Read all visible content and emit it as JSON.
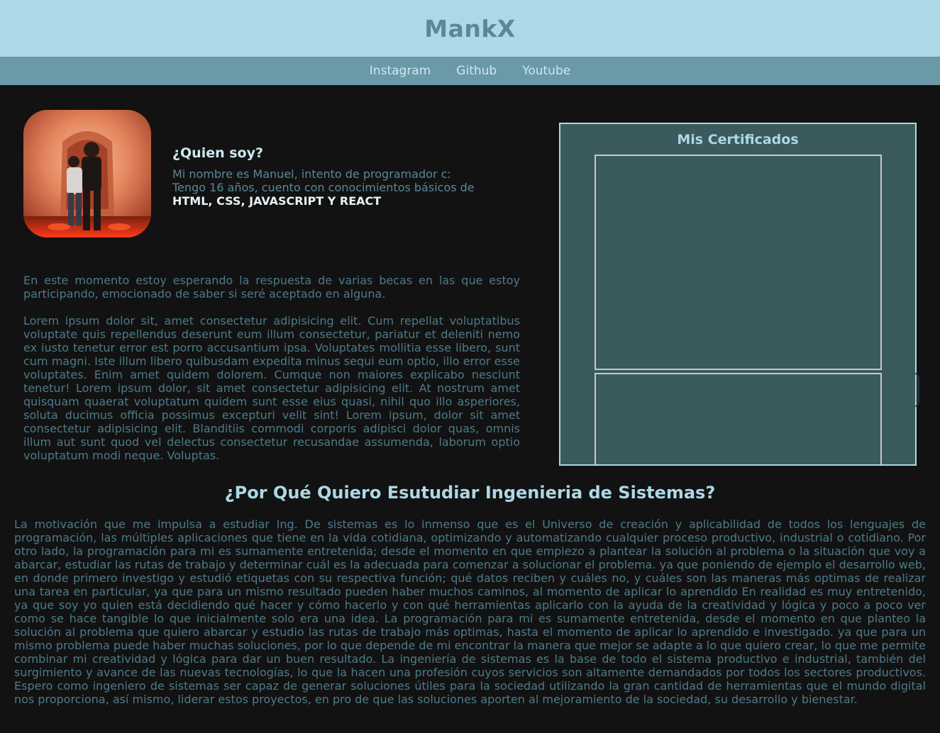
{
  "header": {
    "title": "MankX"
  },
  "nav": {
    "links": [
      {
        "label": "Instagram"
      },
      {
        "label": "Github"
      },
      {
        "label": "Youtube"
      }
    ]
  },
  "about": {
    "heading": "¿Quien soy?",
    "line1": "Mi nombre es Manuel, intento de programador c:",
    "line2": "Tengo 16 años, cuento con conocimientos básicos de",
    "skills": "HTML, CSS, JAVASCRIPT Y REACT"
  },
  "intro": {
    "paragraph1": "En este momento estoy esperando la respuesta de varias becas en las que estoy participando, emocionado de saber si seré aceptado en alguna.",
    "paragraph2": "Lorem ipsum dolor sit, amet consectetur adipisicing elit. Cum repellat voluptatibus voluptate quis repellendus deserunt eum illum consectetur, pariatur et deleniti nemo ex iusto tenetur error est porro accusantium ipsa. Voluptates mollitia esse libero, sunt cum magni. Iste illum libero quibusdam expedita minus sequi eum optio, illo error esse voluptates. Enim amet quidem dolorem. Cumque non maiores explicabo nesciunt tenetur! Lorem ipsum dolor, sit amet consectetur adipisicing elit. At nostrum amet quisquam quaerat voluptatum quidem sunt esse eius quasi, nihil quo illo asperiores, soluta ducimus officia possimus excepturi velit sint! Lorem ipsum, dolor sit amet consectetur adipisicing elit. Blanditiis commodi corporis adipisci dolor quas, omnis illum aut sunt quod vel delectus consectetur recusandae assumenda, laborum optio voluptatum modi neque. Voluptas."
  },
  "certificates": {
    "title": "Mis Certificados"
  },
  "why": {
    "heading": "¿Por Qué Quiero Esutudiar Ingenieria de Sistemas?",
    "text": "La motivación que me impulsa a estudiar Ing. De sistemas es lo inmenso que es el Universo de creación y aplicabilidad de todos los lenguajes de programación, las múltiples aplicaciones que tiene en la vida cotidiana, optimizando y automatizando cualquier proceso productivo, industrial o cotidiano. Por otro lado, la programación para mi es sumamente entretenida; desde el momento en que empiezo a plantear la solución al problema o la situación que voy a abarcar, estudiar las rutas de trabajo y determinar cuál es la adecuada para comenzar a solucionar el problema. ya que poniendo de ejemplo el desarrollo web, en donde primero investigo y estudió etiquetas con su respectiva función; qué datos reciben y cuáles no, y cuáles son las maneras más optimas de realizar una tarea en particular, ya que para un mismo resultado pueden haber muchos caminos, al momento de aplicar lo aprendido En realidad es muy entretenido, ya que soy yo quien está decidiendo qué hacer y cómo hacerlo y con qué herramientas aplicarlo con la ayuda de la creatividad y lógica y poco a poco ver como se hace tangible lo que inicialmente solo era una idea. La programación para mi es sumamente entretenida, desde el momento en que planteo la solución al problema que quiero abarcar y estudio las rutas de trabajo más optimas, hasta el momento de aplicar lo aprendido e investigado. ya que para un mismo problema puede haber muchas soluciones, por lo que depende de mi encontrar la manera que mejor se adapte a lo que quiero crear, lo que me permite combinar mi creatividad y lógica para dar un buen resultado. La ingeniería de sistemas es la base de todo el sistema productivo e industrial, también del surgimiento y avance de las nuevas tecnologías, lo que la hacen una profesión cuyos servicios son altamente demandados por todos los sectores productivos. Espero como ingeniero de sistemas ser capaz de generar soluciones útiles para la sociedad utilizando la gran cantidad de herramientas que el mundo digital nos proporciona, así mismo, liderar estos proyectos, en pro de que las soluciones aporten al mejoramiento de la sociedad, su desarrollo y bienestar."
  }
}
